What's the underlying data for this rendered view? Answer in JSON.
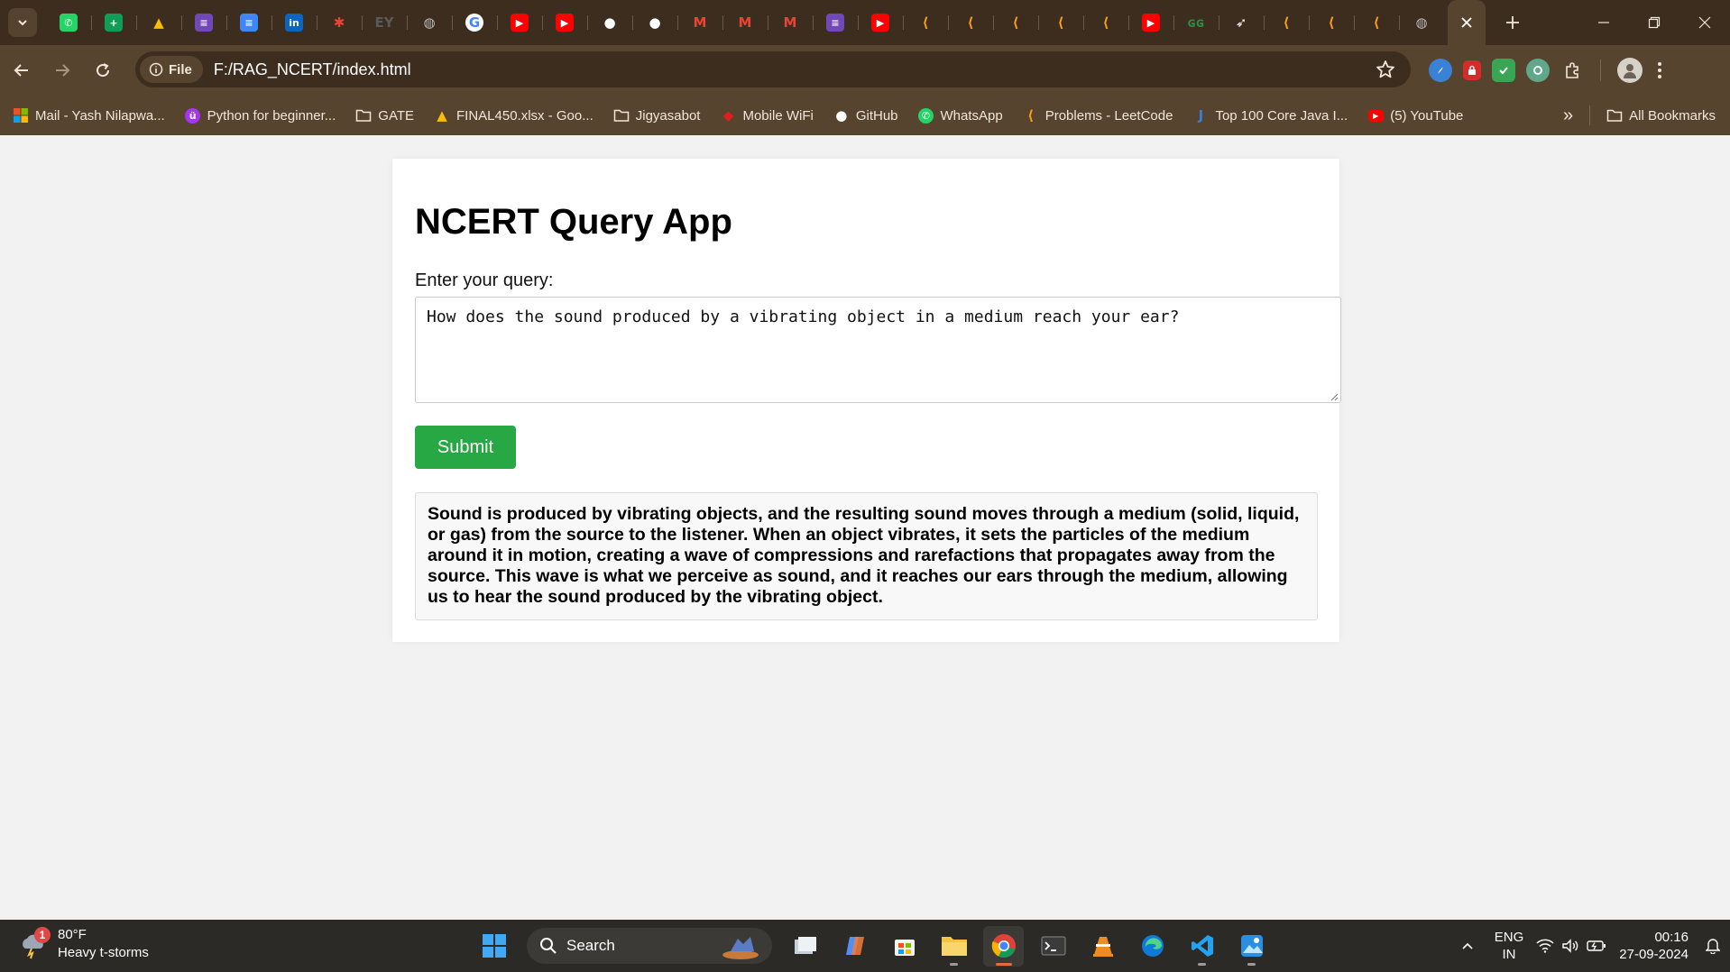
{
  "browser": {
    "tabs": [
      {
        "icon": "whatsapp-icon",
        "color": "#25d366"
      },
      {
        "icon": "google-sheets-icon",
        "color": "#0f9d58"
      },
      {
        "icon": "google-drive-icon",
        "color": "#fbbc04"
      },
      {
        "icon": "forms-icon",
        "color": "#7248b9"
      },
      {
        "icon": "google-docs-icon",
        "color": "#4285f4"
      },
      {
        "icon": "linkedin-icon",
        "color": "#0a66c2"
      },
      {
        "icon": "pinwheel-icon",
        "color": "#ea4335"
      },
      {
        "icon": "ey-icon",
        "color": "#5a5a5a"
      },
      {
        "icon": "globe-icon",
        "color": "#bcbcbc"
      },
      {
        "icon": "google-icon",
        "color": "#ffffff"
      },
      {
        "icon": "youtube-icon",
        "color": "#ff0000"
      },
      {
        "icon": "youtube-icon",
        "color": "#ff0000"
      },
      {
        "icon": "github-icon",
        "color": "#ffffff"
      },
      {
        "icon": "github-icon",
        "color": "#ffffff"
      },
      {
        "icon": "gmail-icon",
        "color": "#ea4335"
      },
      {
        "icon": "gmail-icon",
        "color": "#ea4335"
      },
      {
        "icon": "gmail-icon",
        "color": "#ea4335"
      },
      {
        "icon": "forms-icon",
        "color": "#7248b9"
      },
      {
        "icon": "youtube-icon",
        "color": "#ff0000"
      },
      {
        "icon": "leetcode-icon",
        "color": "#ffa116"
      },
      {
        "icon": "leetcode-icon",
        "color": "#ffa116"
      },
      {
        "icon": "leetcode-icon",
        "color": "#ffa116"
      },
      {
        "icon": "leetcode-icon",
        "color": "#ffa116"
      },
      {
        "icon": "leetcode-icon",
        "color": "#ffa116"
      },
      {
        "icon": "youtube-icon",
        "color": "#ff0000"
      },
      {
        "icon": "geeksforgeeks-icon",
        "color": "#2f8d46"
      },
      {
        "icon": "rocket-icon",
        "color": "#ffffff"
      },
      {
        "icon": "leetcode-icon",
        "color": "#ffa116"
      },
      {
        "icon": "leetcode-icon",
        "color": "#ffa116"
      },
      {
        "icon": "leetcode-icon",
        "color": "#ffa116"
      },
      {
        "icon": "globe-icon",
        "color": "#bcbcbc"
      }
    ],
    "address": {
      "chip_label": "File",
      "url": "F:/RAG_NCERT/index.html"
    },
    "bookmarks": [
      {
        "label": "Mail - Yash Nilapwa...",
        "icon": "microsoft-icon",
        "color": "#f25022"
      },
      {
        "label": "Python for beginner...",
        "icon": "udemy-icon",
        "color": "#a435f0"
      },
      {
        "label": "GATE",
        "icon": "folder-icon",
        "color": "#f0e6da"
      },
      {
        "label": "FINAL450.xlsx - Goo...",
        "icon": "google-drive-icon",
        "color": "#fbbc04"
      },
      {
        "label": "Jigyasabot",
        "icon": "folder-icon",
        "color": "#f0e6da"
      },
      {
        "label": "Mobile WiFi",
        "icon": "wifi-brand-icon",
        "color": "#e01e1e"
      },
      {
        "label": "GitHub",
        "icon": "github-icon",
        "color": "#ffffff"
      },
      {
        "label": "WhatsApp",
        "icon": "whatsapp-icon",
        "color": "#25d366"
      },
      {
        "label": "Problems - LeetCode",
        "icon": "leetcode-icon",
        "color": "#ffa116"
      },
      {
        "label": "Top 100 Core Java I...",
        "icon": "java-icon",
        "color": "#3b7bd9"
      },
      {
        "label": "(5) YouTube",
        "icon": "youtube-icon",
        "color": "#ff0000"
      }
    ],
    "all_bookmarks_label": "All Bookmarks",
    "overflow_label": "»"
  },
  "page": {
    "title": "NCERT Query App",
    "query_label": "Enter your query:",
    "query_value": "How does the sound produced by a vibrating object in a medium reach your ear?",
    "submit_label": "Submit",
    "answer": "Sound is produced by vibrating objects, and the resulting sound moves through a medium (solid, liquid, or gas) from the source to the listener. When an object vibrates, it sets the particles of the medium around it in motion, creating a wave of compressions and rarefactions that propagates away from the source. This wave is what we perceive as sound, and it reaches our ears through the medium, allowing us to hear the sound produced by the vibrating object.",
    "submit_color": "#28a745"
  },
  "taskbar": {
    "weather_badge": "1",
    "temperature": "80°F",
    "condition": "Heavy t-storms",
    "search_label": "Search",
    "lang_top": "ENG",
    "lang_bottom": "IN",
    "time": "00:16",
    "date": "27-09-2024"
  }
}
